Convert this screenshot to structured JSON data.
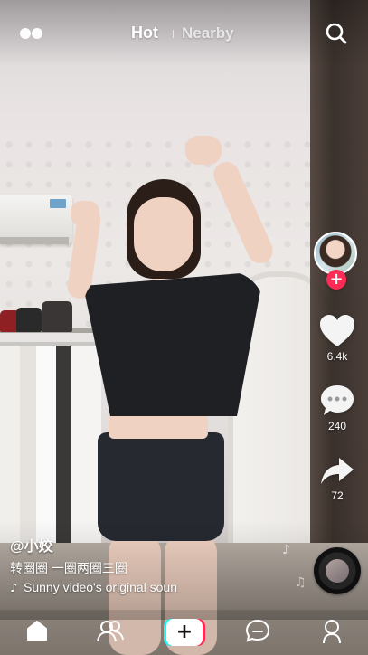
{
  "top_bar": {
    "live_icon": "live-dots-icon",
    "tabs": [
      {
        "label": "Hot",
        "active": true
      },
      {
        "label": "Nearby",
        "active": false
      }
    ],
    "search_icon": "search-icon"
  },
  "creator": {
    "avatar_icon": "avatar",
    "follow_label": "+"
  },
  "actions": {
    "like": {
      "icon": "heart-icon",
      "count": "6.4k"
    },
    "comment": {
      "icon": "comment-icon",
      "count": "240"
    },
    "share": {
      "icon": "share-arrow-icon",
      "count": "72"
    }
  },
  "video": {
    "username": "@小姣",
    "description": "转圈圈 一圈两圈三圈",
    "music_glyph": "♪",
    "music_text": "Sunny video's original soun"
  },
  "music_notes": [
    "♪",
    "♫"
  ],
  "bottom_nav": {
    "home_icon": "home-icon",
    "friends_icon": "friends-icon",
    "create_label": "+",
    "messages_icon": "message-icon",
    "profile_icon": "profile-icon"
  },
  "colors": {
    "accent_red": "#fe2c55",
    "accent_cyan": "#25f4ee"
  }
}
